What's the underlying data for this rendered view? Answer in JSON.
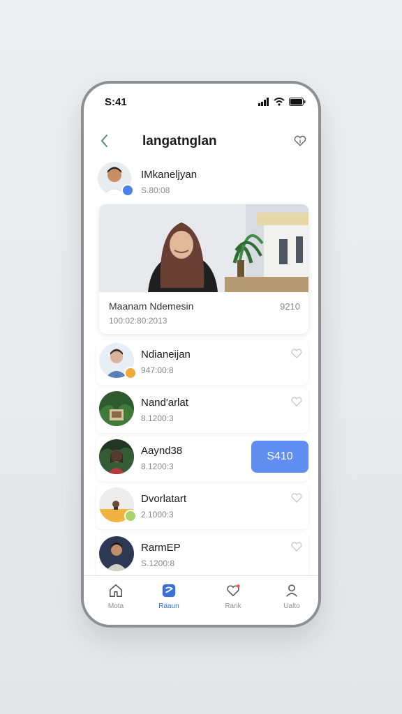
{
  "status_bar": {
    "time": "S:41",
    "icons": [
      "signal-icon",
      "wifi-icon",
      "battery-icon"
    ]
  },
  "header": {
    "title": "langatnglan"
  },
  "profile": {
    "name": "IMkaneljyan",
    "subtitle": "S.80:08"
  },
  "feature": {
    "name": "Maanam Ndemesin",
    "subtitle": "100:02:80:2013",
    "value": "9210"
  },
  "list": [
    {
      "name": "Ndianeijan",
      "subtitle": "947:00:8",
      "action": "heart",
      "badge_color": "#f2a93b"
    },
    {
      "name": "Nand'arlat",
      "subtitle": "8.1200:3",
      "action": "heart"
    },
    {
      "name": "Aaynd38",
      "subtitle": "8.1200:3",
      "action": "pill",
      "pill_label": "S410"
    },
    {
      "name": "Dvorlatart",
      "subtitle": "2.1000:3",
      "action": "heart",
      "badge_color": "#a9d36a"
    },
    {
      "name": "RarmEP",
      "subtitle": "S.1200:8",
      "action": "heart"
    }
  ],
  "tabs": [
    {
      "label": "Mota",
      "icon": "home-icon"
    },
    {
      "label": "Raaun",
      "icon": "shield-icon",
      "active": true
    },
    {
      "label": "Rarik",
      "icon": "chat-heart-icon"
    },
    {
      "label": "Ualto",
      "icon": "user-icon"
    }
  ],
  "colors": {
    "accent": "#5f8df0",
    "active_tab": "#3a6fd8",
    "frame": "#8c8f93"
  }
}
